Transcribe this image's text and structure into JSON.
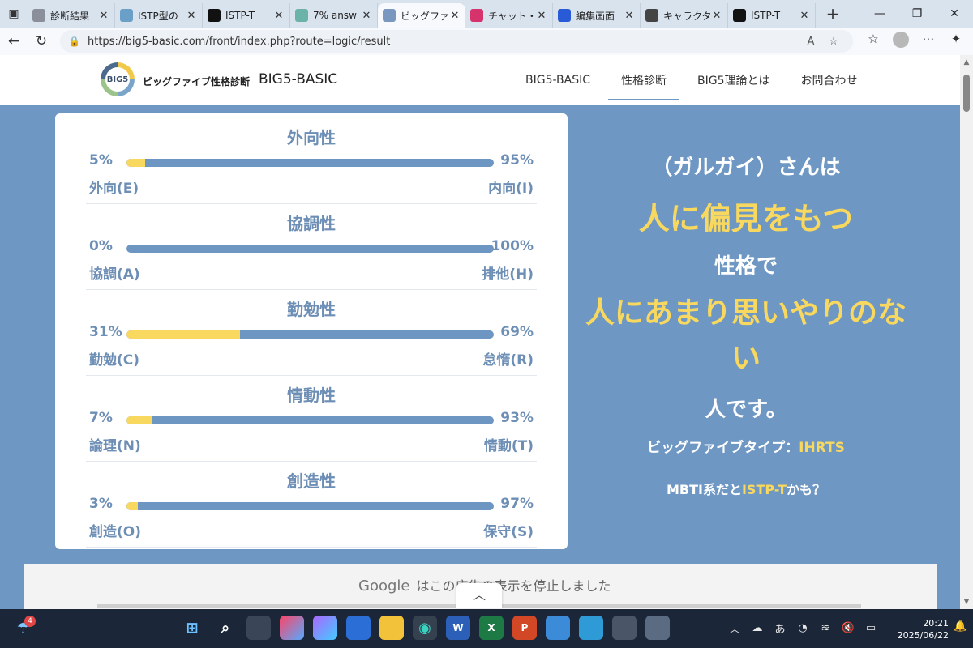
{
  "browser": {
    "tabs": [
      {
        "title": "診断結果",
        "fav_color": "#8a8f99",
        "active": false
      },
      {
        "title": "ISTP型の",
        "fav_color": "#6aa0c8",
        "active": false
      },
      {
        "title": "ISTP-T",
        "fav_color": "#111111",
        "active": false
      },
      {
        "title": "7% answ",
        "fav_color": "#6bb2a8",
        "active": false
      },
      {
        "title": "ビッグファイ",
        "fav_color": "#7a98bf",
        "active": true
      },
      {
        "title": "チャット・",
        "fav_color": "#d6336c",
        "active": false
      },
      {
        "title": "編集画面",
        "fav_color": "#2a5bd7",
        "active": false
      },
      {
        "title": "キャラクター",
        "fav_color": "#444444",
        "active": false
      },
      {
        "title": "ISTP-T",
        "fav_color": "#111111",
        "active": false
      }
    ],
    "url": "https://big5-basic.com/front/index.php?route=logic/result"
  },
  "site": {
    "logo_text": "BIG5",
    "brand_sub": "ビッグファイブ性格診断",
    "brand_main": "BIG5-BASIC",
    "nav": [
      {
        "label": "BIG5-BASIC",
        "active": false
      },
      {
        "label": "性格診断",
        "active": true
      },
      {
        "label": "BIG5理論とは",
        "active": false
      },
      {
        "label": "お問合わせ",
        "active": false
      }
    ]
  },
  "traits": [
    {
      "name": "外向性",
      "left_pct": "5%",
      "right_pct": "95%",
      "left_label": "外向(E)",
      "right_label": "内向(I)",
      "fill": 0.05
    },
    {
      "name": "協調性",
      "left_pct": "0%",
      "right_pct": "100%",
      "left_label": "協調(A)",
      "right_label": "排他(H)",
      "fill": 0.0
    },
    {
      "name": "勤勉性",
      "left_pct": "31%",
      "right_pct": "69%",
      "left_label": "勤勉(C)",
      "right_label": "怠惰(R)",
      "fill": 0.31
    },
    {
      "name": "情動性",
      "left_pct": "7%",
      "right_pct": "93%",
      "left_label": "論理(N)",
      "right_label": "情動(T)",
      "fill": 0.07
    },
    {
      "name": "創造性",
      "left_pct": "3%",
      "right_pct": "97%",
      "left_label": "創造(O)",
      "right_label": "保守(S)",
      "fill": 0.03
    }
  ],
  "result": {
    "line1": "（ガルガイ）さんは",
    "line2": "人に偏見をもつ",
    "line3": "性格で",
    "line4": "人にあまり思いやりのない",
    "line5": "人です。",
    "type_label": "ビッグファイブタイプ：",
    "type_value": "IHRTS",
    "mbti_prefix": "MBTI系だと",
    "mbti_value": "ISTP-T",
    "mbti_suffix": "かも？"
  },
  "ad": {
    "brand": "Google",
    "message": "はこの広告の表示を停止しました"
  },
  "taskbar": {
    "badge_count": "4",
    "time": "20:21",
    "date": "2025/06/22",
    "ime": "あ"
  }
}
